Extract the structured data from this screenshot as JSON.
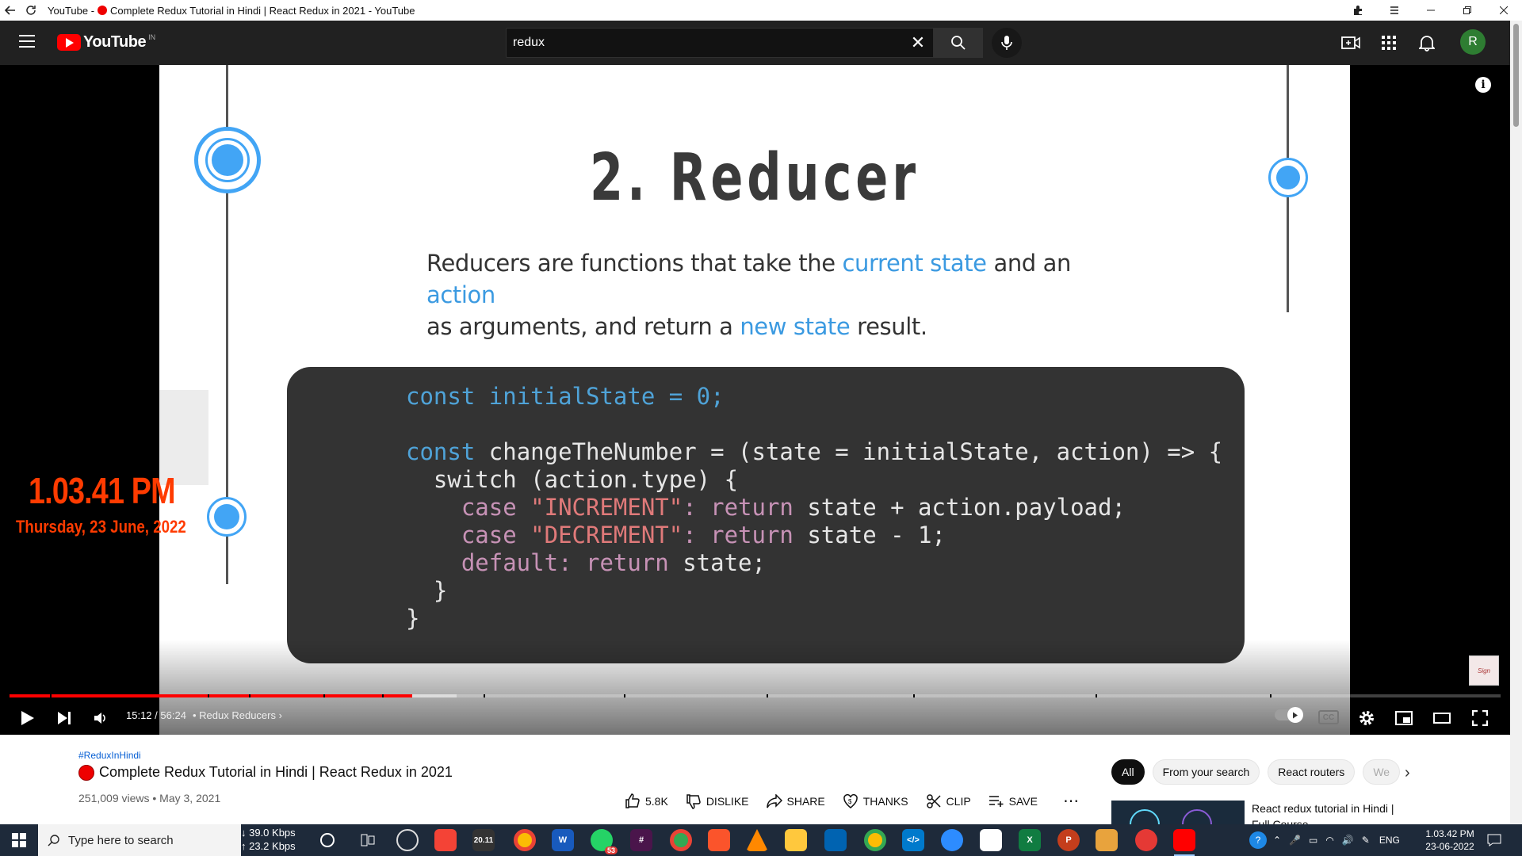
{
  "window": {
    "title": "YouTube - 🔴 Complete Redux Tutorial in Hindi | React Redux in 2021 - YouTube",
    "title_prefix": "YouTube -",
    "title_rest": "Complete Redux Tutorial in Hindi | React Redux in 2021 - YouTube"
  },
  "header": {
    "logo_text": "YouTube",
    "country_code": "IN",
    "search_value": "redux",
    "avatar_letter": "R"
  },
  "slide": {
    "title": "2. Reducer",
    "desc_1": "Reducers are functions that take the ",
    "desc_hl1": "current state",
    "desc_2": " and an ",
    "desc_hl2": "action",
    "desc_3": "as arguments, and return a ",
    "desc_hl3": "new state",
    "desc_4": " result.",
    "code": {
      "l1_kw": "const",
      "l1_rest": " initialState = 0;",
      "l2_kw": "const",
      "l2_rest": " changeTheNumber = (state = initialState, action) => {",
      "l3": "  switch (action.type) {",
      "l4_kw": "    case",
      "l4_str": " \"INCREMENT\"",
      "l4_ret": ": return",
      "l4_rest": " state + action.payload;",
      "l5_kw": "    case",
      "l5_str": " \"DECREMENT\"",
      "l5_ret": ": return",
      "l5_rest": " state - 1;",
      "l6_kw": "    default",
      "l6_ret": ": return",
      "l6_rest": " state;",
      "l7": "  }",
      "l8": "}"
    }
  },
  "overlay_clock": {
    "time": "1.03.41 PM",
    "date": "Thursday, 23 June, 2022"
  },
  "player": {
    "current_time": "15:12",
    "duration": "/ 56:24",
    "chapter": "• Redux Reducers",
    "progress_fraction": 0.27,
    "buffer_fraction": 0.3
  },
  "video": {
    "hashtag": "#ReduxInHindi",
    "title": "Complete Redux Tutorial in Hindi | React Redux in 2021",
    "meta": "251,009 views • May 3, 2021",
    "actions": {
      "like": "5.8K",
      "dislike": "DISLIKE",
      "share": "SHARE",
      "thanks": "THANKS",
      "clip": "CLIP",
      "save": "SAVE"
    }
  },
  "chips": [
    "All",
    "From your search",
    "React routers",
    "We"
  ],
  "recommendation": {
    "title": "React redux tutorial in Hindi | Full Course"
  },
  "taskbar": {
    "search_placeholder": "Type here to search",
    "net_down": "↓ 39.0 Kbps",
    "net_up": "↑ 23.2 Kbps",
    "lang": "ENG",
    "time": "1.03.42 PM",
    "date": "23-06-2022",
    "whatsapp_badge": "53",
    "app_2011": "20.11"
  },
  "colors": {
    "yt_red": "#ff0000",
    "header_bg": "#212121",
    "accent_blue": "#42a5f5",
    "clock_orange": "#ff3b00"
  }
}
